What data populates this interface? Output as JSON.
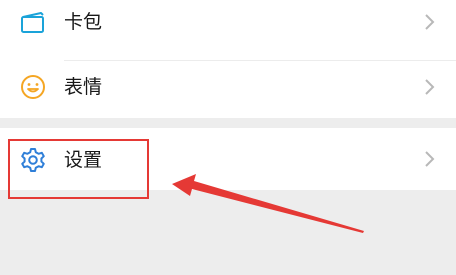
{
  "menu": {
    "items": [
      {
        "label": "卡包",
        "icon": "card-wallet-icon",
        "icon_color": "#1aa3d9"
      },
      {
        "label": "表情",
        "icon": "smiley-icon",
        "icon_color": "#f5a623"
      },
      {
        "label": "设置",
        "icon": "gear-icon",
        "icon_color": "#2f7fd8"
      }
    ]
  },
  "annotation": {
    "highlight_color": "#e53935",
    "target": "设置"
  }
}
